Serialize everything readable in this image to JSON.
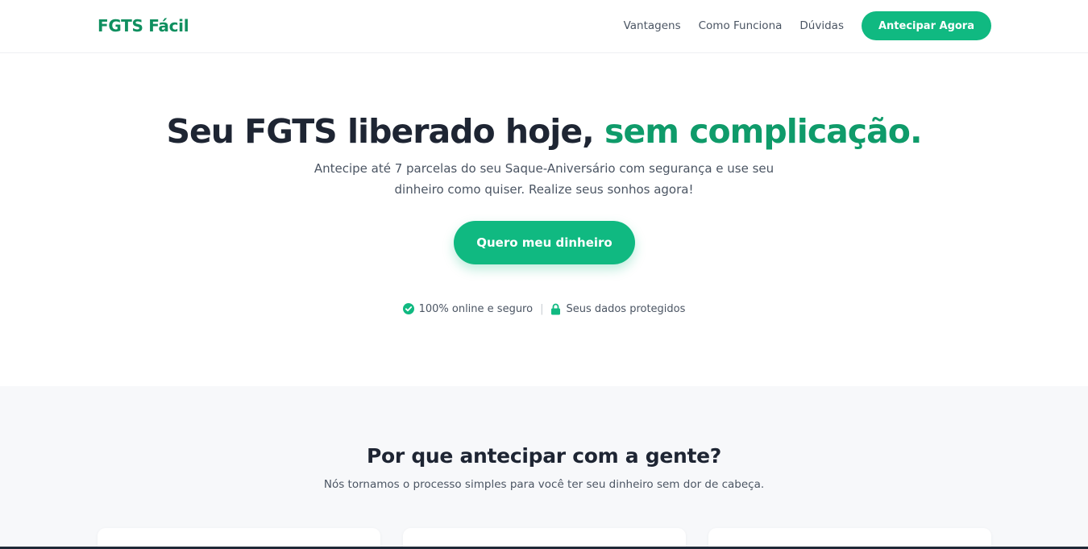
{
  "header": {
    "logo": "FGTS Fácil",
    "nav": [
      "Vantagens",
      "Como Funciona",
      "Dúvidas"
    ],
    "cta_label": "Antecipar Agora"
  },
  "hero": {
    "title_main": "Seu FGTS liberado hoje, ",
    "title_accent": "sem complicação.",
    "subtitle": "Antecipe até 7 parcelas do seu Saque-Aniversário com segurança e use seu dinheiro como quiser. Realize seus sonhos agora!",
    "cta_label": "Quero meu dinheiro",
    "trust": {
      "online": "100% online e seguro",
      "separator": "|",
      "protected": "Seus dados protegidos"
    }
  },
  "why": {
    "title": "Por que antecipar com a gente?",
    "subtitle": "Nós tornamos o processo simples para você ter seu dinheiro sem dor de cabeça."
  },
  "colors": {
    "brand": "#10b981",
    "brand_dark": "#0f9b6a",
    "text": "#1e2533"
  },
  "icons": {
    "online": "check-circle-icon",
    "protected": "lock-icon"
  }
}
